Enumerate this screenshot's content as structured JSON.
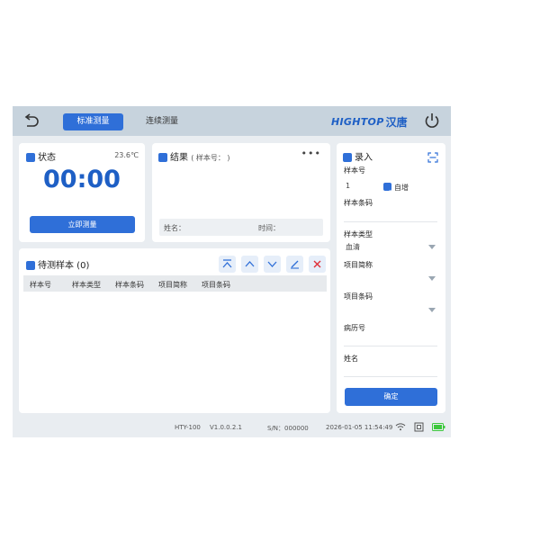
{
  "topbar": {
    "tabs": [
      {
        "label": "标准测量",
        "active": true
      },
      {
        "label": "连续测量",
        "active": false
      }
    ],
    "brand_en": "HIGHTOP",
    "brand_cn": "汉唐",
    "icons": [
      "back-icon",
      "power-icon"
    ]
  },
  "status_panel": {
    "title": "状态",
    "temperature": "23.6℃",
    "timer": "00:00",
    "button_label": "立即测量"
  },
  "result_panel": {
    "title": "结果",
    "subtitle": "( 样本号：           )",
    "more": "•••",
    "name_label": "姓名：",
    "time_label": "时间："
  },
  "pending_panel": {
    "title": "待测样本 (0)",
    "toolbar_icons": [
      "move-top-icon",
      "move-up-icon",
      "move-down-icon",
      "edit-icon",
      "delete-icon"
    ],
    "columns": [
      "样本号",
      "样本类型",
      "样本条码",
      "项目简称",
      "项目条码"
    ],
    "rows": []
  },
  "entry_panel": {
    "title": "录入",
    "sample_no_label": "样本号",
    "sample_no_value": "1",
    "auto_increment_label": "自增",
    "auto_increment_checked": true,
    "barcode_label": "样本条码",
    "sample_type_label": "样本类型",
    "sample_type_value": "血清",
    "item_abbr_label": "项目简称",
    "item_barcode_label": "项目条码",
    "record_no_label": "病历号",
    "name_label": "姓名",
    "confirm_label": "确定"
  },
  "statusbar": {
    "model": "HTY-100",
    "version": "V1.0.0.2.1",
    "serial": "S/N：000000",
    "datetime": "2026-01-05 11:54:49"
  },
  "colors": {
    "accent": "#2f6fd8",
    "brand": "#1e5fc5",
    "topbar": "#c7d3dd",
    "background": "#e9edf1",
    "delete": "#e0303a",
    "battery": "#3cc83c"
  }
}
